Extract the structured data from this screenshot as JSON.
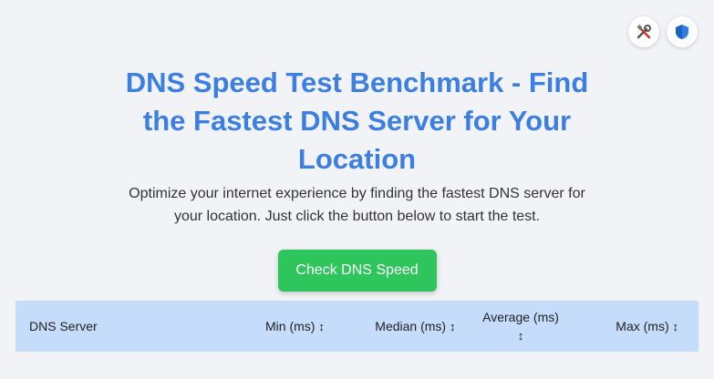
{
  "header": {
    "title": "DNS Speed Test Benchmark - Find the Fastest DNS Server for Your Location",
    "subtitle": "Optimize your internet experience by finding the fastest DNS server for your location. Just click the button below to start the test."
  },
  "actions": {
    "check_label": "Check DNS Speed"
  },
  "icons": {
    "tools": "tools-icon",
    "shield": "shield-icon"
  },
  "table": {
    "columns": [
      "DNS Server",
      "Min (ms)",
      "Median (ms)",
      "Average (ms)",
      "Max (ms)"
    ],
    "sort_symbol": "↕"
  },
  "colors": {
    "accent": "#3c7fe0",
    "button": "#2ec55c",
    "table_header": "#c5dcfb",
    "background": "#f1f3f6"
  }
}
